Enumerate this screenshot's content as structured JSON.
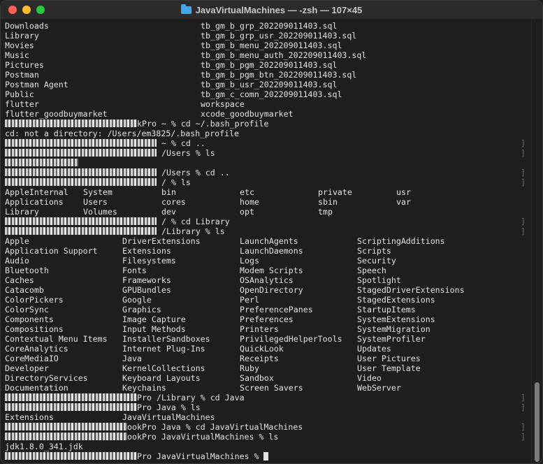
{
  "window": {
    "title": "JavaVirtualMachines — -zsh — 107×45"
  },
  "lines": [
    {
      "cols": [
        {
          "c": 0,
          "t": "Downloads"
        },
        {
          "c": 40,
          "t": "tb_gm_b_grp_202209011403.sql"
        }
      ]
    },
    {
      "cols": [
        {
          "c": 0,
          "t": "Library"
        },
        {
          "c": 40,
          "t": "tb_gm_b_grp_usr_202209011403.sql"
        }
      ]
    },
    {
      "cols": [
        {
          "c": 0,
          "t": "Movies"
        },
        {
          "c": 40,
          "t": "tb_gm_b_menu_202209011403.sql"
        }
      ]
    },
    {
      "cols": [
        {
          "c": 0,
          "t": "Music"
        },
        {
          "c": 40,
          "t": "tb_gm_b_menu_auth_202209011403.sql"
        }
      ]
    },
    {
      "cols": [
        {
          "c": 0,
          "t": "Pictures"
        },
        {
          "c": 40,
          "t": "tb_gm_b_pgm_202209011403.sql"
        }
      ]
    },
    {
      "cols": [
        {
          "c": 0,
          "t": "Postman"
        },
        {
          "c": 40,
          "t": "tb_gm_b_pgm_btn_202209011403.sql"
        }
      ]
    },
    {
      "cols": [
        {
          "c": 0,
          "t": "Postman Agent"
        },
        {
          "c": 40,
          "t": "tb_gm_b_usr_202209011403.sql"
        }
      ]
    },
    {
      "cols": [
        {
          "c": 0,
          "t": "Public"
        },
        {
          "c": 40,
          "t": "tb_gm_c_comn_202209011403.sql"
        }
      ]
    },
    {
      "cols": [
        {
          "c": 0,
          "t": "flutter"
        },
        {
          "c": 40,
          "t": "workspace"
        }
      ]
    },
    {
      "cols": [
        {
          "c": 0,
          "t": "flutter_goodbuymarket"
        },
        {
          "c": 40,
          "t": "xcode_goodbuymarket"
        }
      ]
    },
    {
      "redact": 27,
      "t": "kPro ~ % cd ~/.bash_profile"
    },
    {
      "cols": [
        {
          "c": 0,
          "t": "cd: not a directory: /Users/em3825/.bash_profile"
        }
      ]
    },
    {
      "redact": 31,
      "t": " ~ % cd ..",
      "bracket": true
    },
    {
      "redact": 31,
      "t": " /Users % ls",
      "bracket": true
    },
    {
      "redact": 15,
      "t": ""
    },
    {
      "redact": 31,
      "t": " /Users % cd ..",
      "bracket": true
    },
    {
      "redact": 31,
      "t": " / % ls",
      "bracket": true
    },
    {
      "cols": [
        {
          "c": 0,
          "t": "AppleInternal"
        },
        {
          "c": 16,
          "t": "System"
        },
        {
          "c": 32,
          "t": "bin"
        },
        {
          "c": 48,
          "t": "etc"
        },
        {
          "c": 64,
          "t": "private"
        },
        {
          "c": 80,
          "t": "usr"
        }
      ]
    },
    {
      "cols": [
        {
          "c": 0,
          "t": "Applications"
        },
        {
          "c": 16,
          "t": "Users"
        },
        {
          "c": 32,
          "t": "cores"
        },
        {
          "c": 48,
          "t": "home"
        },
        {
          "c": 64,
          "t": "sbin"
        },
        {
          "c": 80,
          "t": "var"
        }
      ]
    },
    {
      "cols": [
        {
          "c": 0,
          "t": "Library"
        },
        {
          "c": 16,
          "t": "Volumes"
        },
        {
          "c": 32,
          "t": "dev"
        },
        {
          "c": 48,
          "t": "opt"
        },
        {
          "c": 64,
          "t": "tmp"
        }
      ]
    },
    {
      "redact": 31,
      "t": " / % cd Library",
      "bracket": true
    },
    {
      "redact": 31,
      "t": " /Library % ls",
      "bracket": true
    },
    {
      "cols": [
        {
          "c": 0,
          "t": "Apple"
        },
        {
          "c": 24,
          "t": "DriverExtensions"
        },
        {
          "c": 48,
          "t": "LaunchAgents"
        },
        {
          "c": 72,
          "t": "ScriptingAdditions"
        }
      ]
    },
    {
      "cols": [
        {
          "c": 0,
          "t": "Application Support"
        },
        {
          "c": 24,
          "t": "Extensions"
        },
        {
          "c": 48,
          "t": "LaunchDaemons"
        },
        {
          "c": 72,
          "t": "Scripts"
        }
      ]
    },
    {
      "cols": [
        {
          "c": 0,
          "t": "Audio"
        },
        {
          "c": 24,
          "t": "Filesystems"
        },
        {
          "c": 48,
          "t": "Logs"
        },
        {
          "c": 72,
          "t": "Security"
        }
      ]
    },
    {
      "cols": [
        {
          "c": 0,
          "t": "Bluetooth"
        },
        {
          "c": 24,
          "t": "Fonts"
        },
        {
          "c": 48,
          "t": "Modem Scripts"
        },
        {
          "c": 72,
          "t": "Speech"
        }
      ]
    },
    {
      "cols": [
        {
          "c": 0,
          "t": "Caches"
        },
        {
          "c": 24,
          "t": "Frameworks"
        },
        {
          "c": 48,
          "t": "OSAnalytics"
        },
        {
          "c": 72,
          "t": "Spotlight"
        }
      ]
    },
    {
      "cols": [
        {
          "c": 0,
          "t": "Catacomb"
        },
        {
          "c": 24,
          "t": "GPUBundles"
        },
        {
          "c": 48,
          "t": "OpenDirectory"
        },
        {
          "c": 72,
          "t": "StagedDriverExtensions"
        }
      ]
    },
    {
      "cols": [
        {
          "c": 0,
          "t": "ColorPickers"
        },
        {
          "c": 24,
          "t": "Google"
        },
        {
          "c": 48,
          "t": "Perl"
        },
        {
          "c": 72,
          "t": "StagedExtensions"
        }
      ]
    },
    {
      "cols": [
        {
          "c": 0,
          "t": "ColorSync"
        },
        {
          "c": 24,
          "t": "Graphics"
        },
        {
          "c": 48,
          "t": "PreferencePanes"
        },
        {
          "c": 72,
          "t": "StartupItems"
        }
      ]
    },
    {
      "cols": [
        {
          "c": 0,
          "t": "Components"
        },
        {
          "c": 24,
          "t": "Image Capture"
        },
        {
          "c": 48,
          "t": "Preferences"
        },
        {
          "c": 72,
          "t": "SystemExtensions"
        }
      ]
    },
    {
      "cols": [
        {
          "c": 0,
          "t": "Compositions"
        },
        {
          "c": 24,
          "t": "Input Methods"
        },
        {
          "c": 48,
          "t": "Printers"
        },
        {
          "c": 72,
          "t": "SystemMigration"
        }
      ]
    },
    {
      "cols": [
        {
          "c": 0,
          "t": "Contextual Menu Items"
        },
        {
          "c": 24,
          "t": "InstallerSandboxes"
        },
        {
          "c": 48,
          "t": "PrivilegedHelperTools"
        },
        {
          "c": 72,
          "t": "SystemProfiler"
        }
      ]
    },
    {
      "cols": [
        {
          "c": 0,
          "t": "CoreAnalytics"
        },
        {
          "c": 24,
          "t": "Internet Plug-Ins"
        },
        {
          "c": 48,
          "t": "QuickLook"
        },
        {
          "c": 72,
          "t": "Updates"
        }
      ]
    },
    {
      "cols": [
        {
          "c": 0,
          "t": "CoreMediaIO"
        },
        {
          "c": 24,
          "t": "Java"
        },
        {
          "c": 48,
          "t": "Receipts"
        },
        {
          "c": 72,
          "t": "User Pictures"
        }
      ]
    },
    {
      "cols": [
        {
          "c": 0,
          "t": "Developer"
        },
        {
          "c": 24,
          "t": "KernelCollections"
        },
        {
          "c": 48,
          "t": "Ruby"
        },
        {
          "c": 72,
          "t": "User Template"
        }
      ]
    },
    {
      "cols": [
        {
          "c": 0,
          "t": "DirectoryServices"
        },
        {
          "c": 24,
          "t": "Keyboard Layouts"
        },
        {
          "c": 48,
          "t": "Sandbox"
        },
        {
          "c": 72,
          "t": "Video"
        }
      ]
    },
    {
      "cols": [
        {
          "c": 0,
          "t": "Documentation"
        },
        {
          "c": 24,
          "t": "Keychains"
        },
        {
          "c": 48,
          "t": "Screen Savers"
        },
        {
          "c": 72,
          "t": "WebServer"
        }
      ]
    },
    {
      "redact": 27,
      "t": "Pro /Library % cd Java",
      "bracket": true
    },
    {
      "redact": 27,
      "t": "Pro Java % ls",
      "bracket": true
    },
    {
      "cols": [
        {
          "c": 0,
          "t": "Extensions"
        },
        {
          "c": 24,
          "t": "JavaVirtualMachines"
        }
      ]
    },
    {
      "redact": 25,
      "t": "ookPro Java % cd JavaVirtualMachines",
      "bracket": true
    },
    {
      "redact": 25,
      "t": "ookPro JavaVirtualMachines % ls",
      "bracket": true
    },
    {
      "cols": [
        {
          "c": 0,
          "t": "jdk1.8.0_341.jdk"
        }
      ]
    },
    {
      "redact": 27,
      "t": "Pro JavaVirtualMachines % ",
      "cursor": true
    }
  ]
}
